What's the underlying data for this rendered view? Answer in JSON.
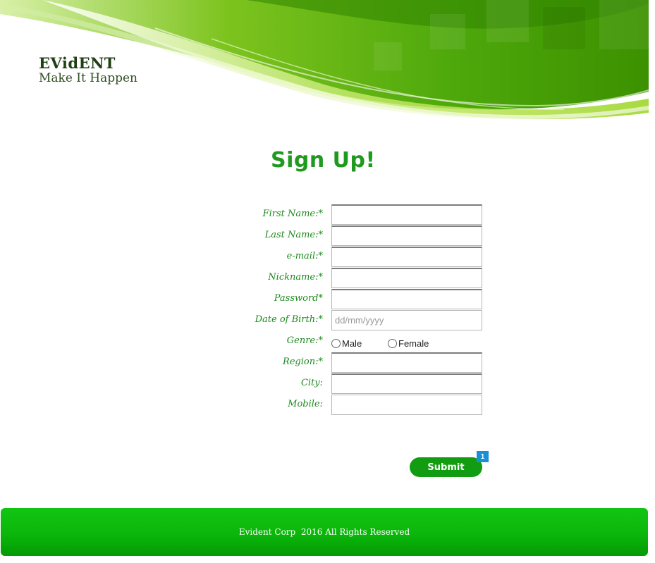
{
  "header": {
    "logo_name": "EVidENT",
    "logo_tagline": "Make It Happen"
  },
  "form": {
    "title": "Sign Up!",
    "fields": [
      {
        "label": "First Name:*",
        "value": "",
        "placeholder": ""
      },
      {
        "label": "Last Name:*",
        "value": "",
        "placeholder": ""
      },
      {
        "label": "e-mail:*",
        "value": "",
        "placeholder": ""
      },
      {
        "label": "Nickname:*",
        "value": "",
        "placeholder": ""
      },
      {
        "label": "Password*",
        "value": "",
        "placeholder": ""
      },
      {
        "label": "Date of Birth:*",
        "value": "",
        "placeholder": "dd/mm/yyyy"
      },
      {
        "label": "Genre:*",
        "options": [
          "Male",
          "Female"
        ]
      },
      {
        "label": "Region:*",
        "value": "",
        "placeholder": ""
      },
      {
        "label": "City:",
        "value": "",
        "placeholder": ""
      },
      {
        "label": "Mobile:",
        "value": "",
        "placeholder": ""
      }
    ],
    "submit_label": "Submit",
    "badge_count": "1"
  },
  "footer": {
    "text": "Evident Corp  2016 All Rights Reserved"
  },
  "colors": {
    "brand_green": "#129c12",
    "label_green": "#1e8a1e",
    "badge_blue": "#1a8fd6"
  }
}
